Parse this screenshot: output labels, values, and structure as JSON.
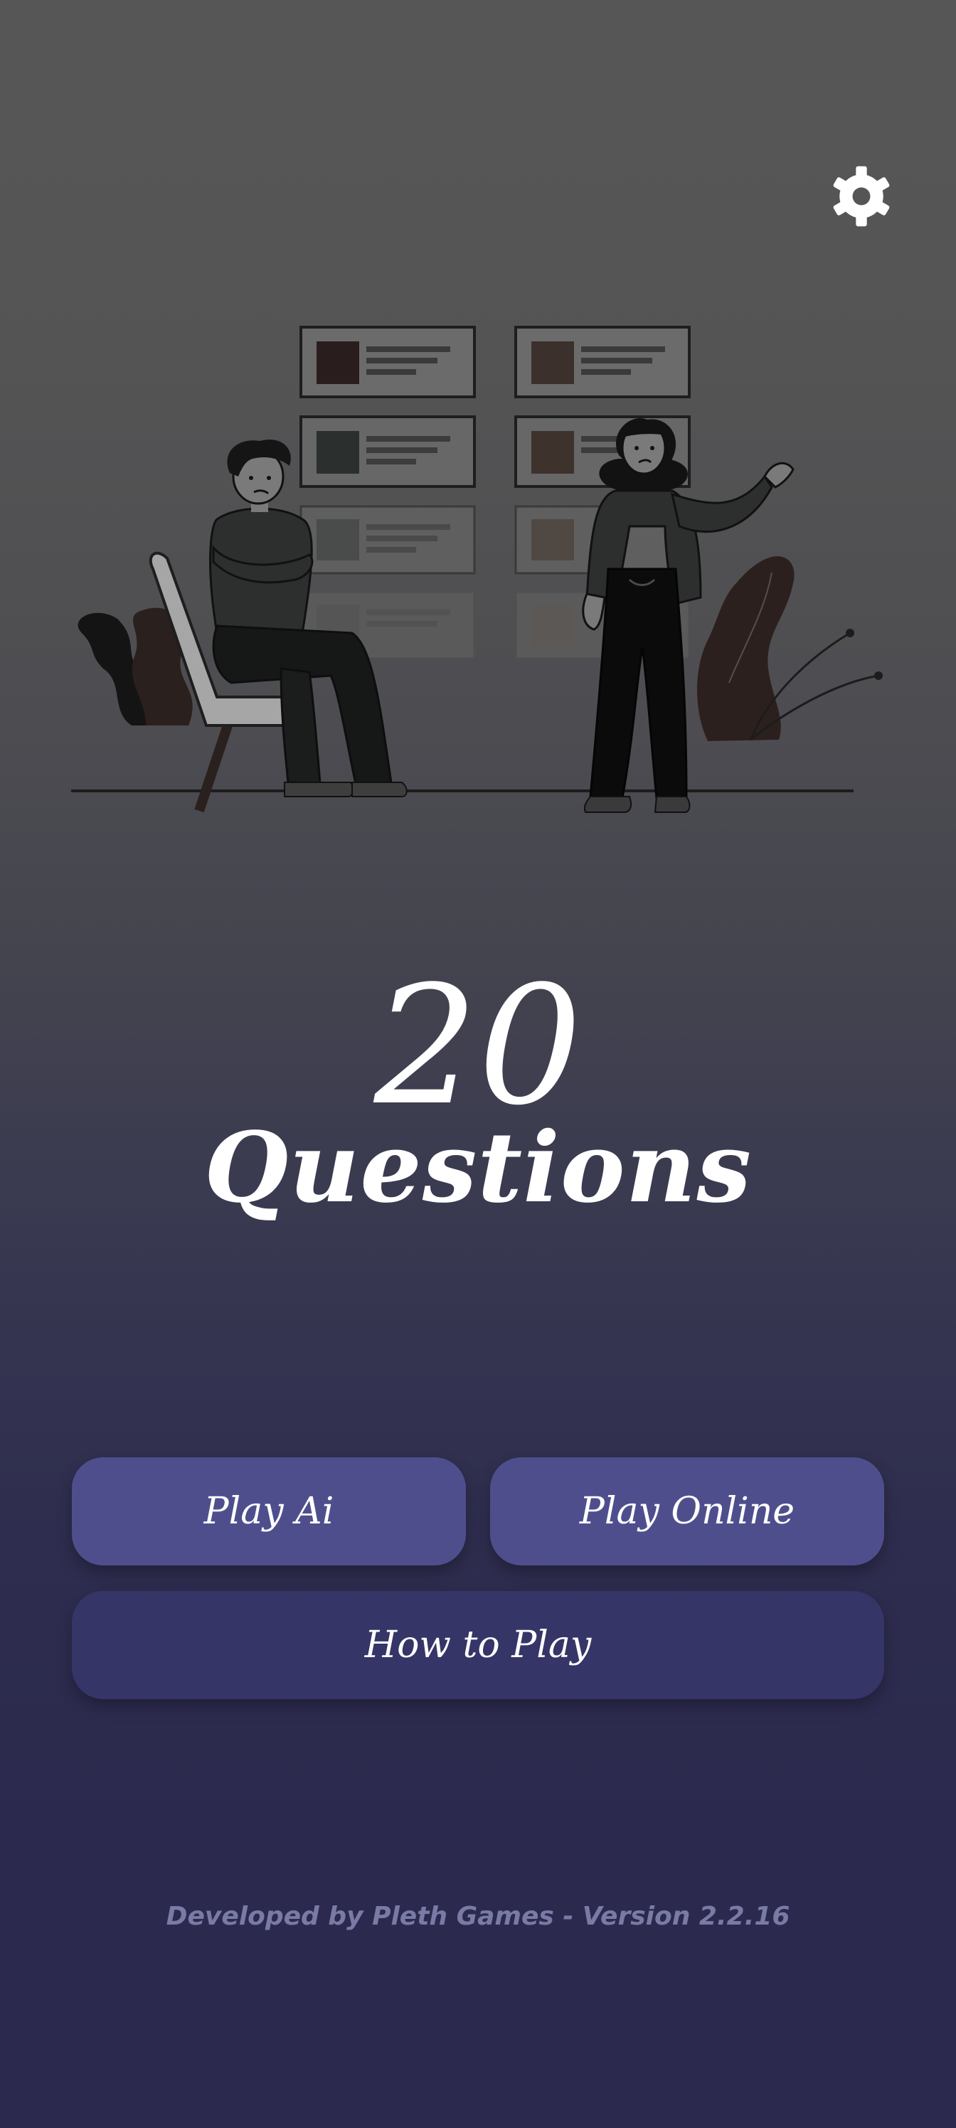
{
  "header": {
    "settings_icon": "gear-icon"
  },
  "title": {
    "number": "20",
    "word": "Questions"
  },
  "buttons": {
    "play_ai": "Play Ai",
    "play_online": "Play Online",
    "how_to_play": "How to Play"
  },
  "footer": {
    "credit": "Developed by Pleth Games - Version 2.2.16"
  },
  "colors": {
    "primary_button": "#4f4e8d",
    "secondary_button": "#363567",
    "background_top": "#565656",
    "background_bottom": "#2b2a4e",
    "footer_text": "#7a7aa6"
  }
}
